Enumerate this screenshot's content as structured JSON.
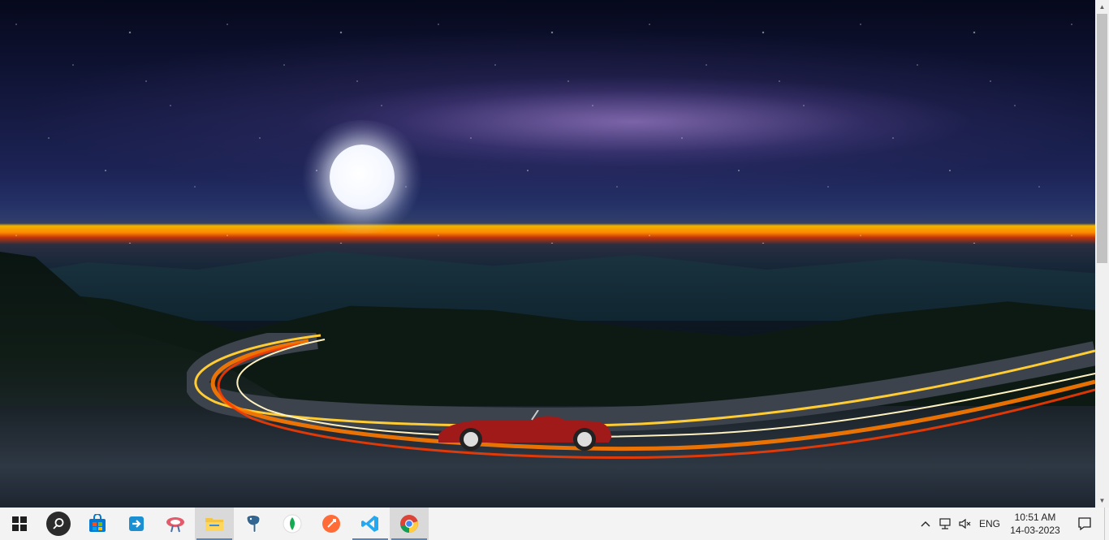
{
  "window": {
    "title": ""
  },
  "scrollbar": {
    "up_icon": "triangle-up",
    "down_icon": "triangle-down"
  },
  "taskbar": {
    "items": [
      {
        "name": "start-button",
        "icon": "windows-logo-icon"
      },
      {
        "name": "search-button",
        "icon": "search-icon"
      },
      {
        "name": "microsoft-store",
        "icon": "store-icon"
      },
      {
        "name": "app-arrow",
        "icon": "app-arrow-icon"
      },
      {
        "name": "app-tool",
        "icon": "tool-icon"
      },
      {
        "name": "file-explorer",
        "icon": "folder-icon"
      },
      {
        "name": "postgresql",
        "icon": "elephant-icon"
      },
      {
        "name": "mongodb-compass",
        "icon": "leaf-icon"
      },
      {
        "name": "postman",
        "icon": "postman-icon"
      },
      {
        "name": "vs-code",
        "icon": "vscode-icon"
      },
      {
        "name": "chrome",
        "icon": "chrome-icon"
      }
    ],
    "tray": {
      "chevron": "^",
      "language": "ENG",
      "time": "10:51 AM",
      "date": "14-03-2023"
    }
  },
  "colors": {
    "taskbar_bg": "#f3f3f3",
    "accent": "#5a86b8",
    "store_blue": "#0078d4",
    "vscode_blue": "#23a9f2",
    "postman_orange": "#ff6c37",
    "mongodb_green": "#13aa52",
    "folder_yellow": "#f4c542"
  }
}
